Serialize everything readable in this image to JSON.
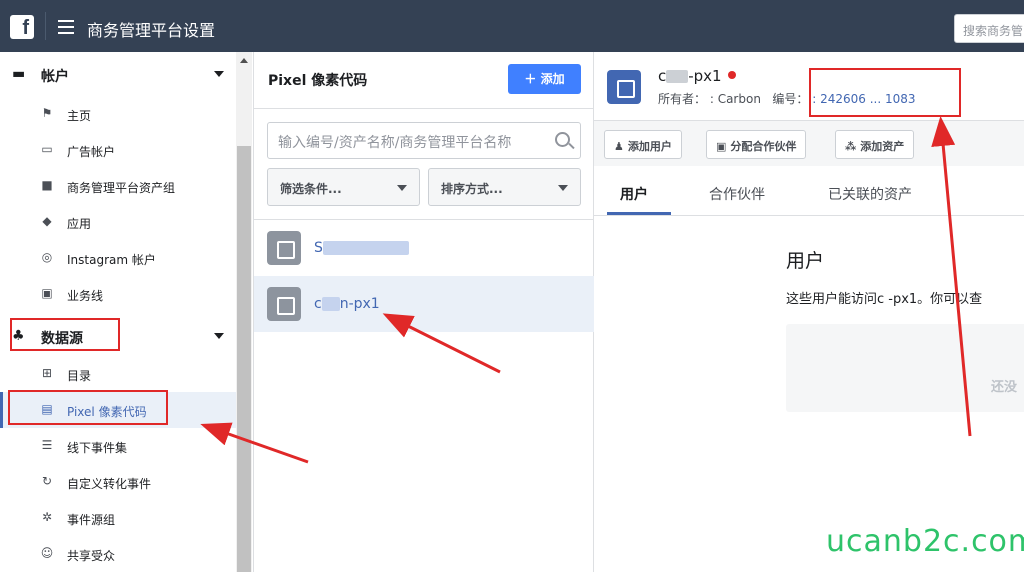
{
  "topbar": {
    "logo": "f",
    "title": "商务管理平台设置",
    "search_placeholder": "搜索商务管"
  },
  "sidebar": {
    "account_section": "帐户",
    "account_items": [
      {
        "label": "主页",
        "icon": "flag-icon"
      },
      {
        "label": "广告帐户",
        "icon": "ad-account-icon"
      },
      {
        "label": "商务管理平台资产组",
        "icon": "folder-icon"
      },
      {
        "label": "应用",
        "icon": "cube-icon"
      },
      {
        "label": "Instagram 帐户",
        "icon": "instagram-icon"
      },
      {
        "label": "业务线",
        "icon": "briefcase-icon"
      }
    ],
    "data_section": "数据源",
    "data_items": [
      {
        "label": "目录",
        "icon": "grid-icon"
      },
      {
        "label": "Pixel 像素代码",
        "icon": "pixel-icon"
      },
      {
        "label": "线下事件集",
        "icon": "database-icon"
      },
      {
        "label": "自定义转化事件",
        "icon": "refresh-icon"
      },
      {
        "label": "事件源组",
        "icon": "nodes-icon"
      },
      {
        "label": "共享受众",
        "icon": "people-icon"
      }
    ]
  },
  "middle": {
    "title": "Pixel 像素代码",
    "add_label": "添加",
    "search_placeholder": "输入编号/资产名称/商务管理平台名称",
    "filter_label": "筛选条件...",
    "sort_label": "排序方式...",
    "pixels": [
      {
        "prefix": "S",
        "suffix": ""
      },
      {
        "prefix": "c",
        "suffix": "n-px1"
      }
    ]
  },
  "right": {
    "title_prefix": "c",
    "title_suffix": "-px1",
    "owner_label": "所有者：",
    "owner_value": ": Carbon",
    "id_label": "编号：",
    "id_value": ": 242606 ... 1083",
    "toolbar": {
      "add_user": "添加用户",
      "assign_partner": "分配合作伙伴",
      "add_asset": "添加资产"
    },
    "tabs": [
      "用户",
      "合作伙伴",
      "已关联的资产"
    ],
    "section_title": "用户",
    "section_desc": "这些用户能访问c  -px1。你可以查",
    "empty_hint": "还没"
  },
  "watermark": "ucanb2c.com",
  "colors": {
    "topbar": "#344154",
    "accent": "#4267b2",
    "add_button": "#4080ff",
    "annotation": "#e02828",
    "watermark": "#2ec36a"
  }
}
